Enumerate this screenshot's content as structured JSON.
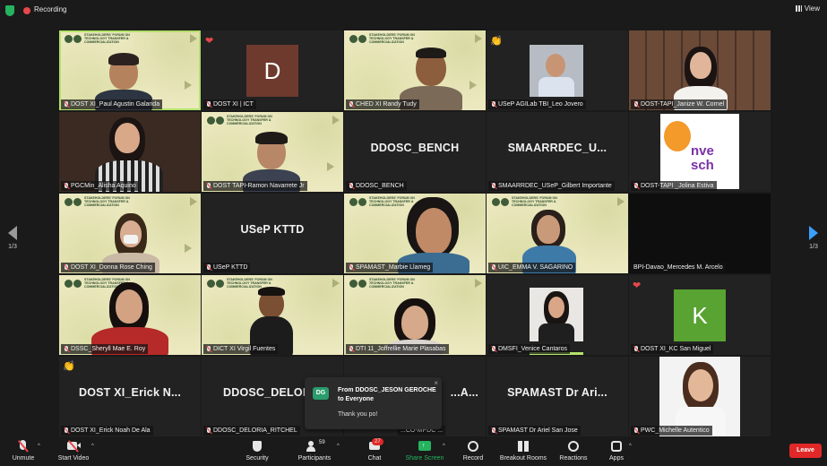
{
  "topbar": {
    "recording_label": "Recording",
    "view_label": "View"
  },
  "banner_text": "STAKEHOLDERS' FORUM ON TECHNOLOGY TRANSFER & COMMERCIALIZATION",
  "page_indicator": {
    "left": "1/3",
    "right": "1/3"
  },
  "tiles": [
    {
      "name": "DOST XI_Paul Agustin Galarida",
      "big": "",
      "avatar": ""
    },
    {
      "name": "DOST XI | ICT",
      "big": "",
      "avatar": "D"
    },
    {
      "name": "CHED XI Randy Tudy",
      "big": "",
      "avatar": ""
    },
    {
      "name": "USeP AGILab TBI_Leo Jovero",
      "big": "",
      "avatar": ""
    },
    {
      "name": "DOST-TAPI_Janize W. Cornel",
      "big": "",
      "avatar": ""
    },
    {
      "name": "PGCMin_Alisha Aquino",
      "big": "",
      "avatar": ""
    },
    {
      "name": "DOST TAPI-Ramon Navarrete Jr",
      "big": "",
      "avatar": ""
    },
    {
      "name": "DDOSC_BENCH",
      "big": "DDOSC_BENCH",
      "avatar": ""
    },
    {
      "name": "SMAARRDEC_USeP_Gilbert Importante",
      "big": "SMAARRDEC_U...",
      "avatar": ""
    },
    {
      "name": "DOST-TAPI _Jolina Estiva",
      "big": "",
      "avatar": ""
    },
    {
      "name": "DOST XI_Donna Rose Ching",
      "big": "",
      "avatar": ""
    },
    {
      "name": "USeP KTTD",
      "big": "USeP KTTD",
      "avatar": ""
    },
    {
      "name": "SPAMAST_Marbie Llameg",
      "big": "",
      "avatar": ""
    },
    {
      "name": "UIC_EMMA V. SAGARINO",
      "big": "",
      "avatar": ""
    },
    {
      "name": "BPI-Davao_Mercedes M. Arcelo",
      "big": "",
      "avatar": ""
    },
    {
      "name": "DSSC_Sheryll Mae E. Roy",
      "big": "",
      "avatar": ""
    },
    {
      "name": "DICT XI Virgil Fuentes",
      "big": "",
      "avatar": ""
    },
    {
      "name": "DTI 11_Joffrellie Marie Plasabas",
      "big": "",
      "avatar": ""
    },
    {
      "name": "DMSFI_Venice Cantaros",
      "big": "",
      "avatar": ""
    },
    {
      "name": "DOST XI_KC San Miguel",
      "big": "",
      "avatar": "K"
    },
    {
      "name": "DOST XI_Erick Noah De Ala",
      "big": "DOST XI_Erick N...",
      "avatar": ""
    },
    {
      "name": "DDOSC_DELORIA_RITCHEL",
      "big": "DDOSC_DELOR",
      "avatar": ""
    },
    {
      "name": "...CO-MPDC ...",
      "big": "...A...",
      "avatar": ""
    },
    {
      "name": "SPAMAST Dr Ariel San Jose",
      "big": "SPAMAST Dr Ari...",
      "avatar": ""
    },
    {
      "name": "PWC_Michelle Autentico",
      "big": "",
      "avatar": ""
    }
  ],
  "tile5_logo_text": "nve sch",
  "chat": {
    "initials": "DG",
    "from": "From DDOSC_JESON GEROCHE to Everyone",
    "message": "Thank you po!",
    "close": "×"
  },
  "toolbar": {
    "unmute": "Unmute",
    "start_video": "Start Video",
    "security": "Security",
    "participants": "Participants",
    "participants_count": "59",
    "chat": "Chat",
    "chat_badge": "27",
    "share_screen": "Share Screen",
    "record": "Record",
    "breakout_rooms": "Breakout Rooms",
    "reactions": "Reactions",
    "apps": "Apps",
    "leave": "Leave"
  },
  "colors": {
    "active_border": "#b4e46b",
    "leave": "#e02828",
    "share": "#25b35f",
    "accent": "#3aa0ff"
  }
}
